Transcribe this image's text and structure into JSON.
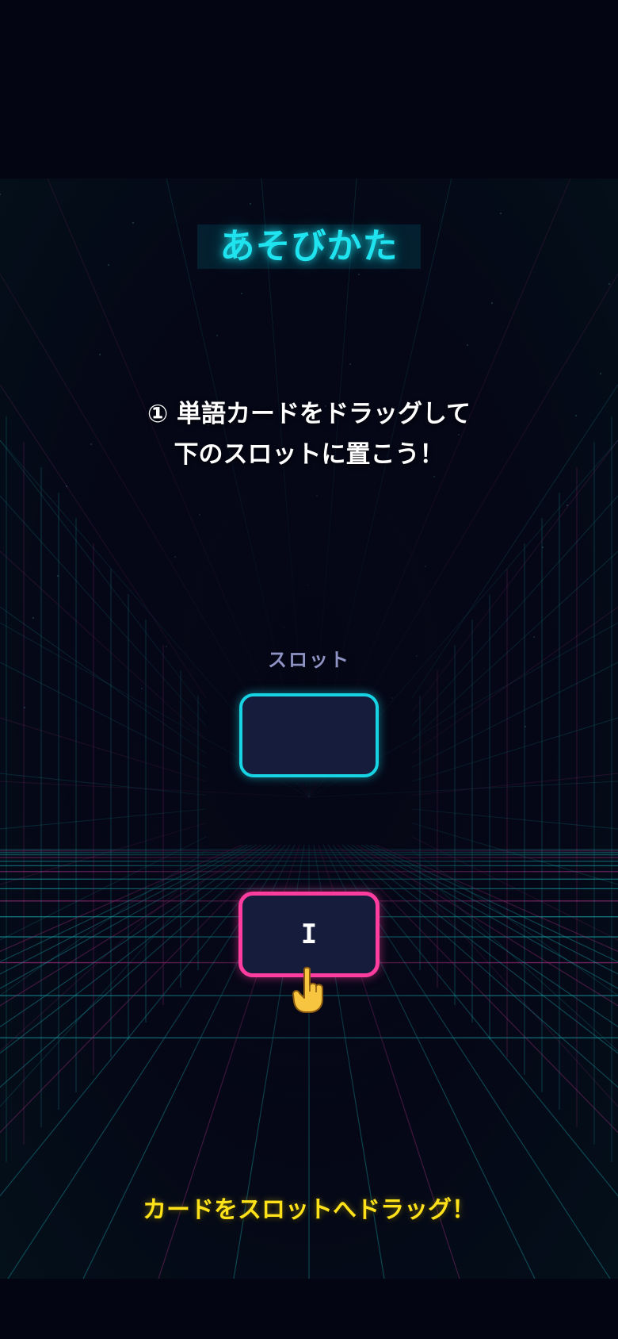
{
  "tutorial": {
    "title": "あそびかた",
    "instruction_line1": "① 単語カードをドラッグして",
    "instruction_line2": "下のスロットに置こう！",
    "slot_label": "スロット",
    "slot_value": "",
    "card_word": "I",
    "hint": "カードをスロットへドラッグ！"
  },
  "icons": {
    "pointer": "hand-pointer-up-icon"
  },
  "colors": {
    "title": "#1fe4f0",
    "slot_border": "#17d3e3",
    "card_border": "#ff3d9f",
    "card_fill": "#161c3c",
    "hint": "#ffe21a",
    "grid_cyan": "#1aa3a8",
    "grid_magenta": "#a0307e",
    "background": "#050614"
  }
}
